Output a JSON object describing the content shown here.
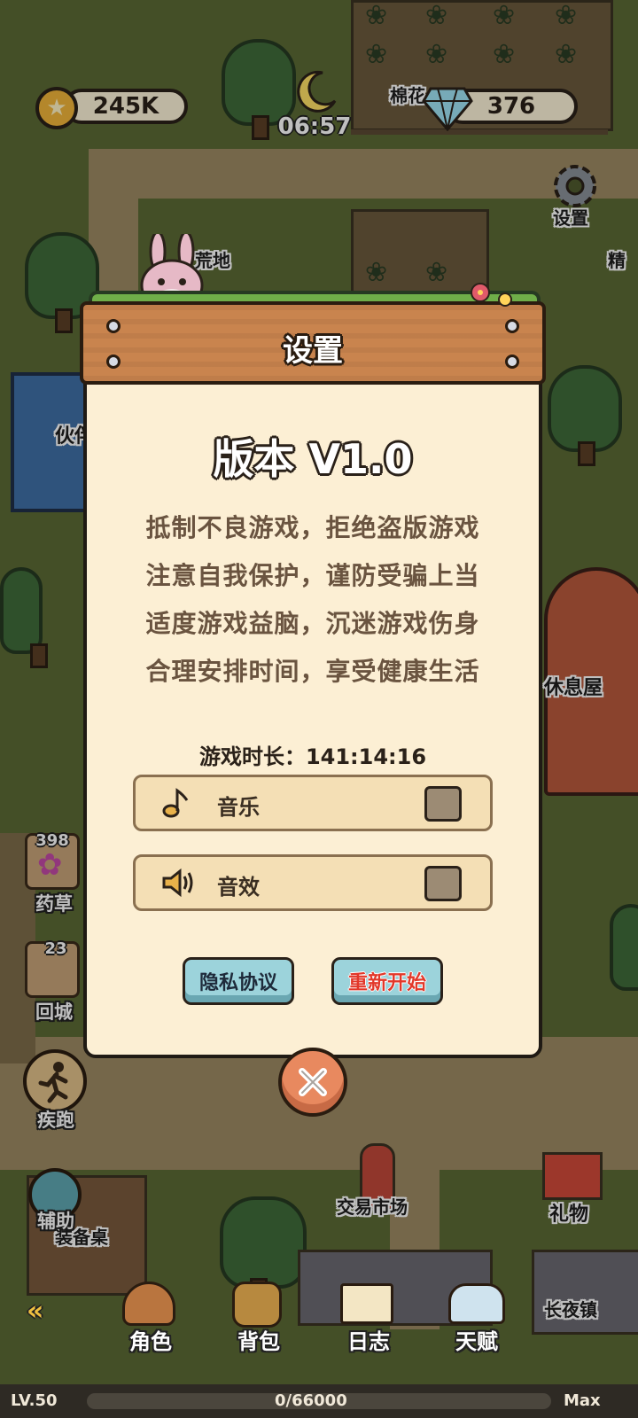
{
  "hud": {
    "coins": "245K",
    "gems": "376",
    "clock": "06:57",
    "settings_label": "设置"
  },
  "world_labels": {
    "cotton": "棉花",
    "wasteland": "荒地",
    "partner": "伙伴",
    "rest_house": "休息屋",
    "trade_market": "交易市场",
    "equipment_table": "装备桌",
    "gift": "礼物",
    "long_night_town": "长夜镇",
    "refine": "精"
  },
  "dialog": {
    "title": "设置",
    "version": "版本 V1.0",
    "notice": [
      "抵制不良游戏，拒绝盗版游戏",
      "注意自我保护，谨防受骗上当",
      "适度游戏益脑，沉迷游戏伤身",
      "合理安排时间，享受健康生活"
    ],
    "playtime_label": "游戏时长：",
    "playtime_value": "141:14:16",
    "music_label": "音乐",
    "sfx_label": "音效",
    "privacy_button": "隐私协议",
    "restart_button": "重新开始"
  },
  "side": {
    "herb_count": "398",
    "herb_label": "药草",
    "return_count": "23",
    "return_label": "回城",
    "sprint_label": "疾跑",
    "assist_label": "辅助"
  },
  "bottom": {
    "tabs": [
      "角色",
      "背包",
      "日志",
      "天赋"
    ],
    "level": "LV.50",
    "xp": "0/66000",
    "max": "Max"
  },
  "colors": {
    "panel_bg": "#fcefd4",
    "header_wood": "#c9844e",
    "button_blue": "#9cd3db",
    "restart_text": "#e2382a"
  }
}
